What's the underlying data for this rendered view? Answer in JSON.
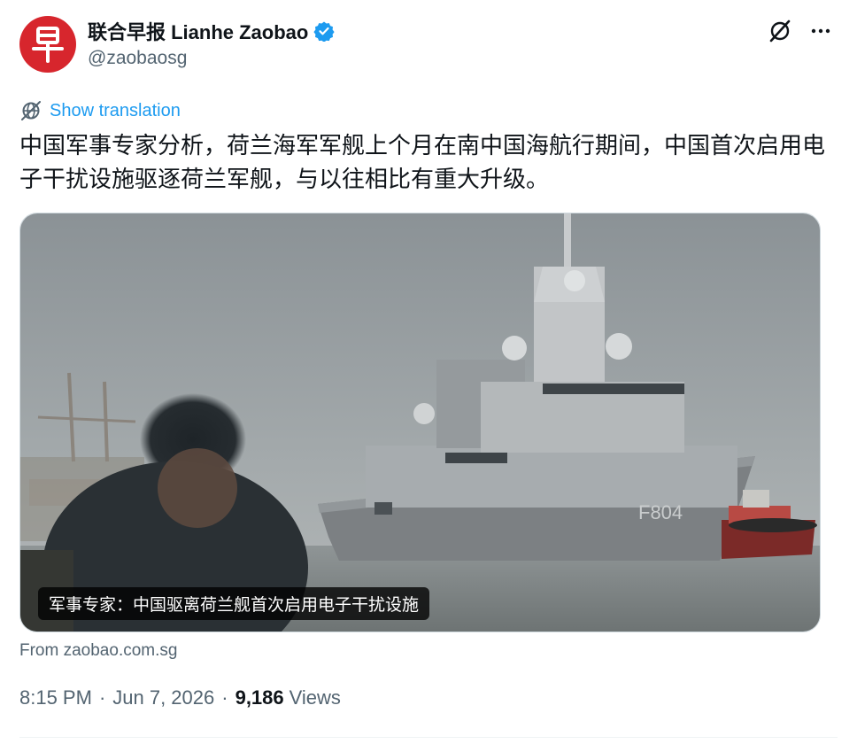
{
  "author": {
    "display_name": "联合早报 Lianhe Zaobao",
    "handle": "@zaobaosg",
    "avatar_glyph": "早",
    "verified": true,
    "avatar_color": "#d7262d",
    "verified_color": "#1d9bf0"
  },
  "header_actions": {
    "grok_icon": "grok-icon",
    "more_icon": "more-icon"
  },
  "translation": {
    "label": "Show translation",
    "icon": "globe-translate-icon",
    "link_color": "#1d9bf0"
  },
  "tweet": {
    "text": "中国军事专家分析，荷兰海军军舰上个月在南中国海航行期间，中国首次启用电子干扰设施驱逐荷兰军舰，与以往相比有重大升级。"
  },
  "media": {
    "caption": "军事专家：中国驱离荷兰舰首次启用电子干扰设施",
    "hull_number": "F804"
  },
  "link_source": "From zaobao.com.sg",
  "meta": {
    "time": "8:15 PM",
    "date": "Jun 7, 2026",
    "separator": "·",
    "views_count": "9,186",
    "views_label": "Views"
  }
}
